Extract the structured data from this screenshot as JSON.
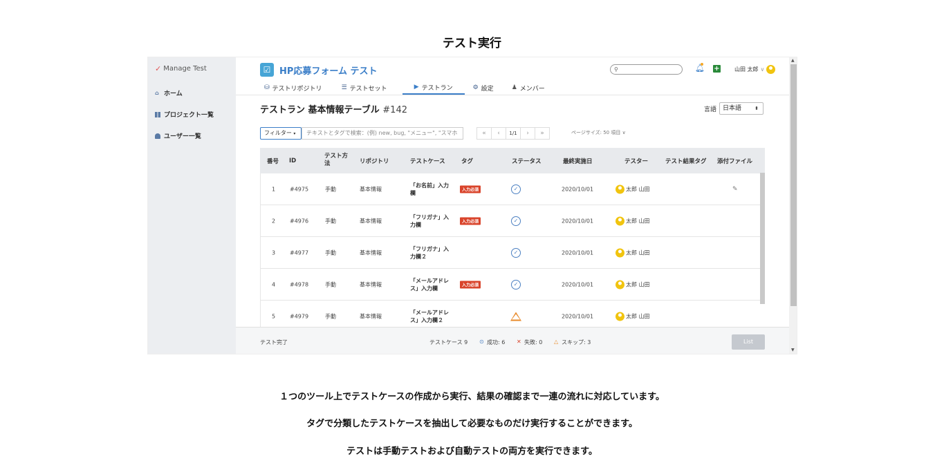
{
  "page": {
    "title": "テスト実行",
    "captions": [
      "１つのツール上でテストケースの作成から実行、結果の確認まで一連の流れに対応しています。",
      "タグで分類したテストケースを抽出して必要なものだけ実行することができます。",
      "テストは手動テストおよび自動テストの両方を実行できます。"
    ]
  },
  "sidebar": {
    "logo": "Manage Test",
    "items": [
      {
        "label": "ホーム",
        "icon": "home-icon"
      },
      {
        "label": "プロジェクト一覧",
        "icon": "grid-icon"
      },
      {
        "label": "ユーザー一覧",
        "icon": "user-icon"
      }
    ]
  },
  "header": {
    "app_name": "HP応募フォーム テスト",
    "user_name": "山田 太郎",
    "search_placeholder": ""
  },
  "tabs": [
    {
      "label": "テストリポジトリ",
      "icon": "database-icon",
      "active": false
    },
    {
      "label": "テストセット",
      "icon": "list-icon",
      "active": false
    },
    {
      "label": "テストラン",
      "icon": "play-icon",
      "active": true
    },
    {
      "label": "設定",
      "icon": "gear-icon",
      "active": false
    },
    {
      "label": "メンバー",
      "icon": "person-icon",
      "active": false
    }
  ],
  "run": {
    "title": "テストラン 基本情報テーブル",
    "number": "#142",
    "lang_label": "言語",
    "lang_value": "日本語"
  },
  "filter": {
    "button": "フィルター",
    "placeholder": "テキストとタグで検索：(例) new, bug, \"メニュー\", \"スマホ"
  },
  "pager": {
    "current": "1/1",
    "page_size": "ページサイズ: 50 項目"
  },
  "table": {
    "headers": {
      "no": "番号",
      "id": "ID",
      "method": "テスト方法",
      "repo": "リポジトリ",
      "case": "テストケース",
      "tag": "タグ",
      "status": "ステータス",
      "date": "最終実施日",
      "tester": "テスター",
      "result_tag": "テスト結果タグ",
      "attach": "添付ファイル"
    },
    "rows": [
      {
        "no": "1",
        "id": "#4975",
        "method": "手動",
        "repo": "基本情報",
        "case": "「お名前」入力欄",
        "tag": "入力必須",
        "status": "success",
        "date": "2020/10/01",
        "tester": "太郎 山田",
        "attach": true
      },
      {
        "no": "2",
        "id": "#4976",
        "method": "手動",
        "repo": "基本情報",
        "case": "「フリガナ」入力欄",
        "tag": "入力必須",
        "status": "success",
        "date": "2020/10/01",
        "tester": "太郎 山田",
        "attach": false
      },
      {
        "no": "3",
        "id": "#4977",
        "method": "手動",
        "repo": "基本情報",
        "case": "「フリガナ」入力欄２",
        "tag": "",
        "status": "success",
        "date": "2020/10/01",
        "tester": "太郎 山田",
        "attach": false
      },
      {
        "no": "4",
        "id": "#4978",
        "method": "手動",
        "repo": "基本情報",
        "case": "「メールアドレス」入力欄",
        "tag": "入力必須",
        "status": "success",
        "date": "2020/10/01",
        "tester": "太郎 山田",
        "attach": false
      },
      {
        "no": "5",
        "id": "#4979",
        "method": "手動",
        "repo": "基本情報",
        "case": "「メールアドレス」入力欄２",
        "tag": "",
        "status": "skip",
        "date": "2020/10/01",
        "tester": "太郎 山田",
        "attach": false
      }
    ]
  },
  "footer": {
    "state": "テスト完了",
    "cases": "テストケース 9",
    "success": "成功: 6",
    "fail": "失敗: 0",
    "skip": "スキップ: 3",
    "list_button": "List"
  }
}
